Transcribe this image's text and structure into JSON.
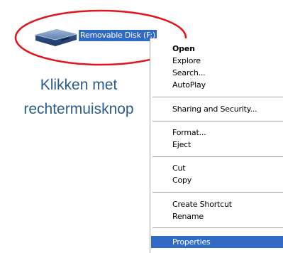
{
  "desktop": {
    "drive_icon": "removable-disk-icon",
    "drive_label": "Removable Disk (F:)"
  },
  "caption": {
    "line1": "Klikken met",
    "line2": "rechtermuisknop"
  },
  "menu": {
    "open": "Open",
    "explore": "Explore",
    "search": "Search...",
    "autoplay": "AutoPlay",
    "sharing": "Sharing and Security...",
    "format": "Format...",
    "eject": "Eject",
    "cut": "Cut",
    "copy": "Copy",
    "create_shortcut": "Create Shortcut",
    "rename": "Rename",
    "properties": "Properties"
  },
  "colors": {
    "selection": "#316ac5",
    "annotation_circle": "#e0161c",
    "caption_text": "#2d5b8a"
  }
}
